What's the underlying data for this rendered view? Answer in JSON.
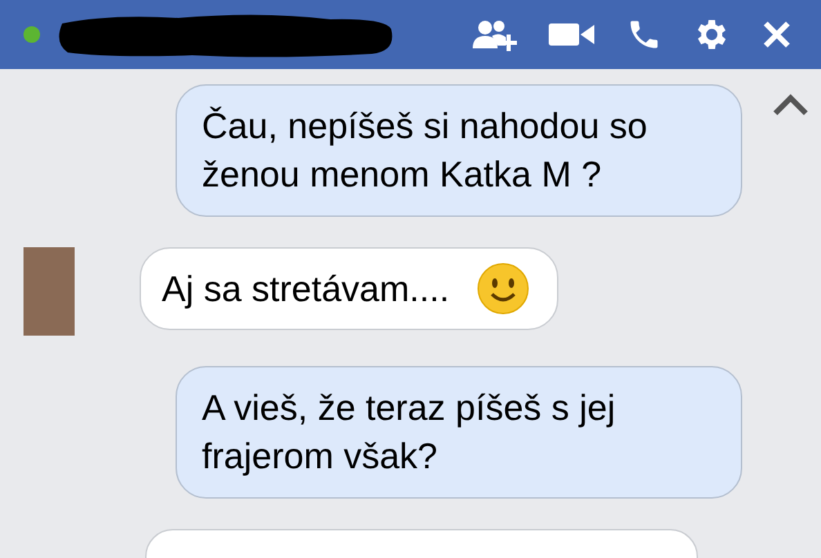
{
  "header": {
    "online": true,
    "actions": [
      {
        "kind": "add-person"
      },
      {
        "kind": "video"
      },
      {
        "kind": "phone"
      },
      {
        "kind": "settings"
      },
      {
        "kind": "close"
      }
    ]
  },
  "messages": [
    {
      "kind": "sent",
      "text": "Čau, nepíšeš si nahodou so ženou menom Katka M ?"
    },
    {
      "kind": "received",
      "text": "Aj sa stretávam....",
      "smiley": true
    },
    {
      "kind": "sent",
      "text": "A vieš, že teraz píšeš s jej frajerom však?"
    },
    {
      "kind": "received_partial"
    }
  ]
}
